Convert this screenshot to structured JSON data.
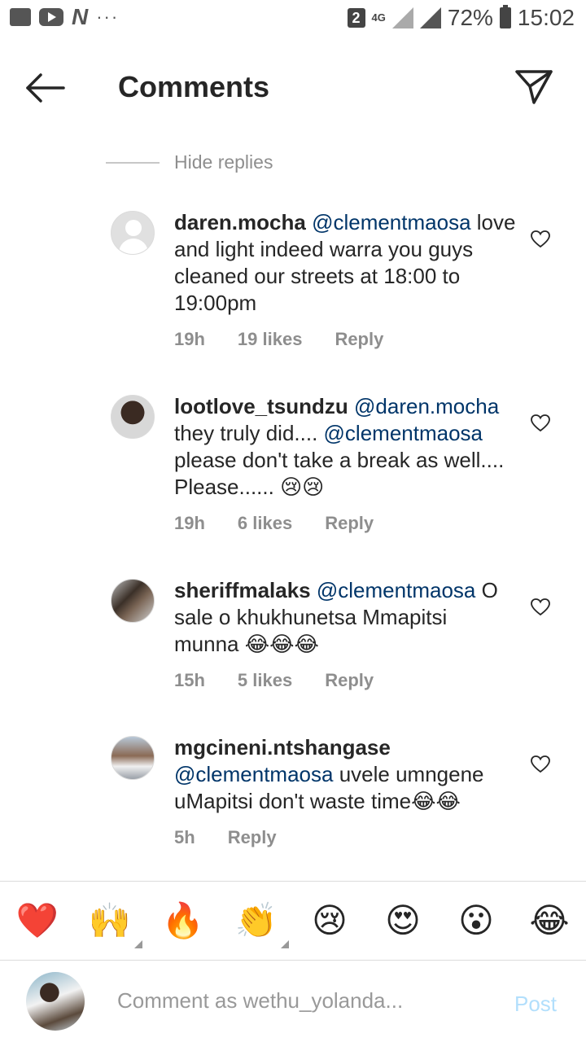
{
  "status_bar": {
    "sim": "2",
    "network": "4G",
    "battery": "72%",
    "time": "15:02",
    "left_icons": [
      "image-icon",
      "youtube-icon",
      "n-app-icon",
      "more-dots-icon"
    ]
  },
  "header": {
    "title": "Comments",
    "back_icon": "arrow-left-icon",
    "send_icon": "paper-plane-icon"
  },
  "hide_replies": "Hide replies",
  "comments": [
    {
      "username": "daren.mocha",
      "mention": "@clementmaosa",
      "text": "love and light indeed warra you guys cleaned our streets at 18:00 to 19:00pm",
      "time": "19h",
      "likes": "19 likes",
      "reply": "Reply",
      "avatar": "default-avatar"
    },
    {
      "username": "lootlove_tsundzu",
      "mention": "@daren.mocha",
      "text_a": "they truly did.... ",
      "mention2": "@clementmaosa",
      "text_b": " please don't take a break as well.... Please...... 😢😢",
      "time": "19h",
      "likes": "6 likes",
      "reply": "Reply",
      "avatar": "user-photo"
    },
    {
      "username": "sheriffmalaks",
      "mention": "@clementmaosa",
      "text": "O sale o khukhunetsa Mmapitsi munna 😂😂😂",
      "time": "15h",
      "likes": "5 likes",
      "reply": "Reply",
      "avatar": "user-photo"
    },
    {
      "username": "mgcineni.ntshangase",
      "mention": "@clementmaosa",
      "text": "uvele umngene uMapitsi don't waste time😂😂",
      "time": "5h",
      "reply": "Reply",
      "avatar": "user-photo"
    }
  ],
  "emoji_bar": [
    "❤️",
    "🙌",
    "🔥",
    "👏",
    "😢",
    "😍",
    "😮",
    "😂"
  ],
  "composer": {
    "placeholder": "Comment as wethu_yolanda...",
    "post_label": "Post"
  },
  "colors": {
    "mention": "#003569",
    "meta": "#8e8e8e",
    "post_disabled": "#b2dffc",
    "text": "#262626"
  }
}
